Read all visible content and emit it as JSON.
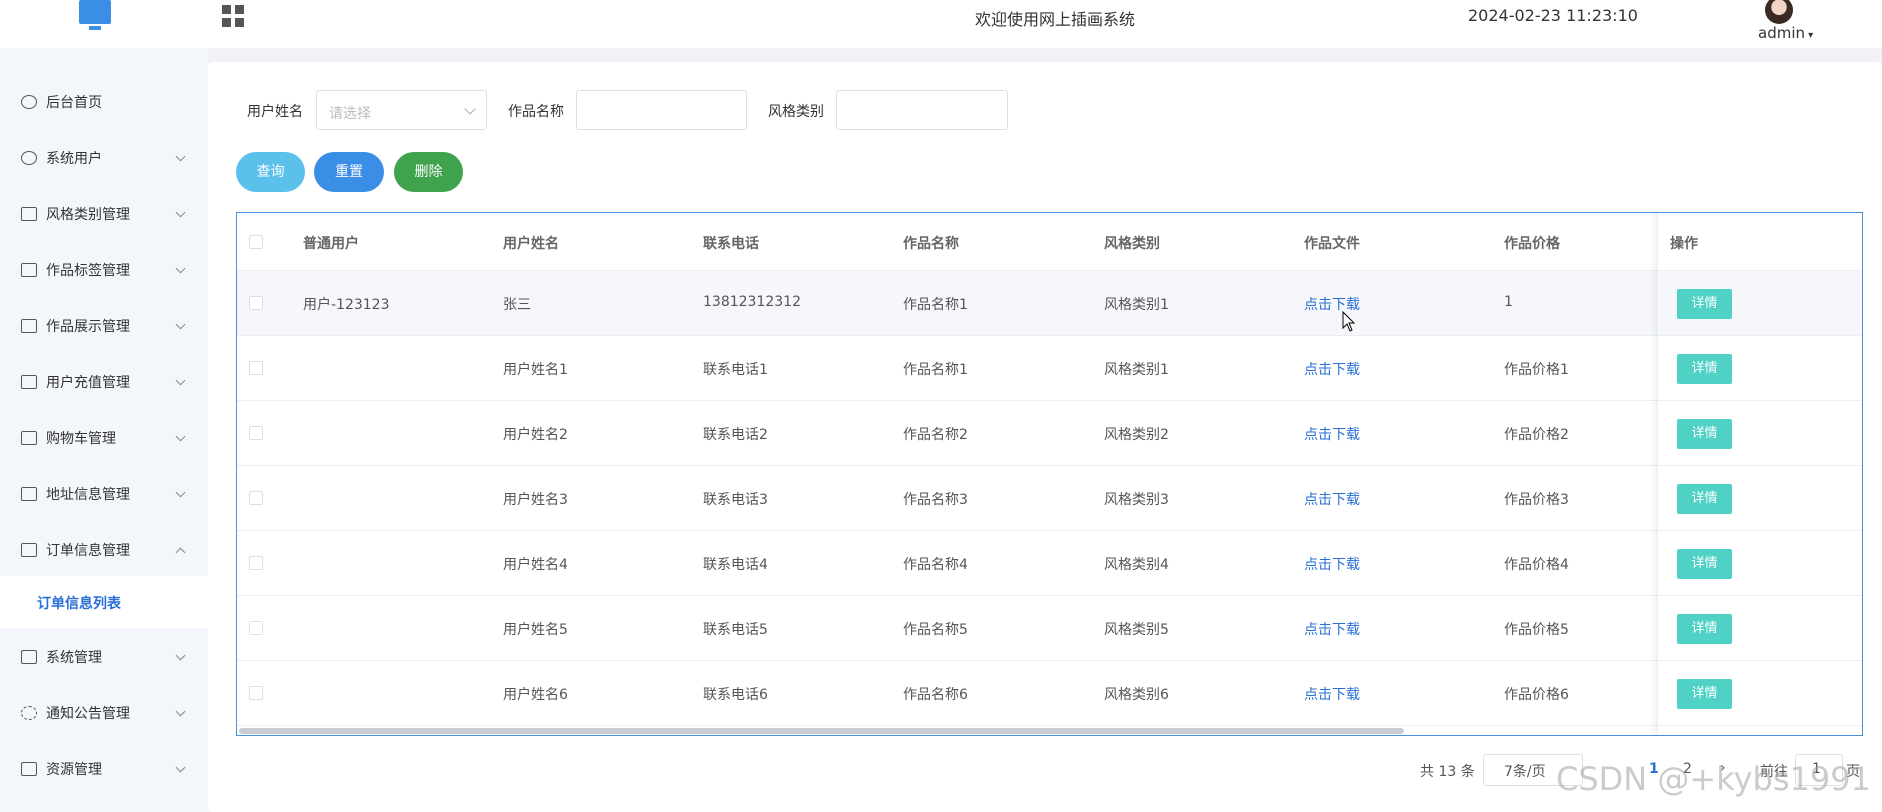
{
  "header": {
    "title": "欢迎使用网上插画系统",
    "datetime": "2024-02-23 11:23:10",
    "user": "admin"
  },
  "sidebar": {
    "items": [
      {
        "label": "后台首页"
      },
      {
        "label": "系统用户"
      },
      {
        "label": "风格类别管理"
      },
      {
        "label": "作品标签管理"
      },
      {
        "label": "作品展示管理"
      },
      {
        "label": "用户充值管理"
      },
      {
        "label": "购物车管理"
      },
      {
        "label": "地址信息管理"
      },
      {
        "label": "订单信息管理"
      },
      {
        "label": "系统管理"
      },
      {
        "label": "通知公告管理"
      },
      {
        "label": "资源管理"
      }
    ],
    "submenu": {
      "label": "订单信息列表"
    }
  },
  "filters": {
    "user_name_label": "用户姓名",
    "user_name_placeholder": "请选择",
    "work_name_label": "作品名称",
    "style_label": "风格类别"
  },
  "buttons": {
    "query": "查询",
    "reset": "重置",
    "delete": "删除"
  },
  "table": {
    "headers": [
      "普通用户",
      "用户姓名",
      "联系电话",
      "作品名称",
      "风格类别",
      "作品文件",
      "作品价格",
      "操作"
    ],
    "rows": [
      [
        "用户-123123",
        "张三",
        "13812312312",
        "作品名称1",
        "风格类别1",
        "点击下载",
        "1"
      ],
      [
        "",
        "用户姓名1",
        "联系电话1",
        "作品名称1",
        "风格类别1",
        "点击下载",
        "作品价格1"
      ],
      [
        "",
        "用户姓名2",
        "联系电话2",
        "作品名称2",
        "风格类别2",
        "点击下载",
        "作品价格2"
      ],
      [
        "",
        "用户姓名3",
        "联系电话3",
        "作品名称3",
        "风格类别3",
        "点击下载",
        "作品价格3"
      ],
      [
        "",
        "用户姓名4",
        "联系电话4",
        "作品名称4",
        "风格类别4",
        "点击下载",
        "作品价格4"
      ],
      [
        "",
        "用户姓名5",
        "联系电话5",
        "作品名称5",
        "风格类别5",
        "点击下载",
        "作品价格5"
      ],
      [
        "",
        "用户姓名6",
        "联系电话6",
        "作品名称6",
        "风格类别6",
        "点击下载",
        "作品价格6"
      ]
    ],
    "detail_label": "详情"
  },
  "pagination": {
    "total": "共 13 条",
    "page_size": "7条/页",
    "page1": "1",
    "page2": "2",
    "goto_prefix": "前往",
    "goto_value": "1",
    "goto_suffix": "页"
  },
  "watermark": "CSDN @+kybs1991",
  "colors": {
    "primary": "#2a6fd6",
    "query_btn": "#5bc0eb",
    "reset_btn": "#3a8ee6",
    "delete_btn": "#3fa34d",
    "detail_btn": "#4fd1c5"
  }
}
